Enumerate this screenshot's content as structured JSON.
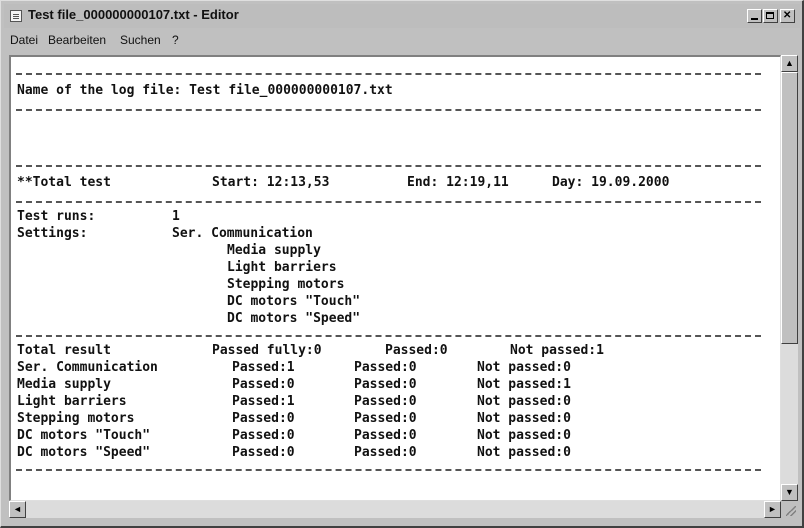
{
  "window": {
    "title": "Test file_000000000107.txt - Editor"
  },
  "menu": {
    "datei": "Datei",
    "bearbeiten": "Bearbeiten",
    "suchen": "Suchen",
    "help": "?"
  },
  "scroll": {
    "up": "▲",
    "down": "▼",
    "left": "◄",
    "right": "►"
  },
  "log": {
    "header": "Name of the log file: Test file_000000000107.txt",
    "total_label": "**Total test",
    "start": "Start: 12:13,53",
    "end": "End: 12:19,11",
    "day": "Day: 19.09.2000",
    "test_runs_label": "Test runs:",
    "test_runs_value": "1",
    "settings_label": "Settings:",
    "settings_first": "Ser. Communication",
    "settings": [
      "Media supply",
      "Light barriers",
      "Stepping motors",
      "DC motors \"Touch\"",
      "DC motors \"Speed\""
    ],
    "summary": {
      "label": "Total result",
      "passed_fully": "Passed fully:0",
      "passed": "Passed:0",
      "not_passed": "Not passed:1"
    },
    "results": [
      {
        "name": "Ser. Communication",
        "passed_a": "Passed:1",
        "passed_b": "Passed:0",
        "not_passed": "Not passed:0"
      },
      {
        "name": "Media supply",
        "passed_a": "Passed:0",
        "passed_b": "Passed:0",
        "not_passed": "Not passed:1"
      },
      {
        "name": "Light barriers",
        "passed_a": "Passed:1",
        "passed_b": "Passed:0",
        "not_passed": "Not passed:0"
      },
      {
        "name": "Stepping motors",
        "passed_a": "Passed:0",
        "passed_b": "Passed:0",
        "not_passed": "Not passed:0"
      },
      {
        "name": "DC motors \"Touch\"",
        "passed_a": "Passed:0",
        "passed_b": "Passed:0",
        "not_passed": "Not passed:0"
      },
      {
        "name": "DC motors \"Speed\"",
        "passed_a": "Passed:0",
        "passed_b": "Passed:0",
        "not_passed": "Not passed:0"
      }
    ]
  }
}
